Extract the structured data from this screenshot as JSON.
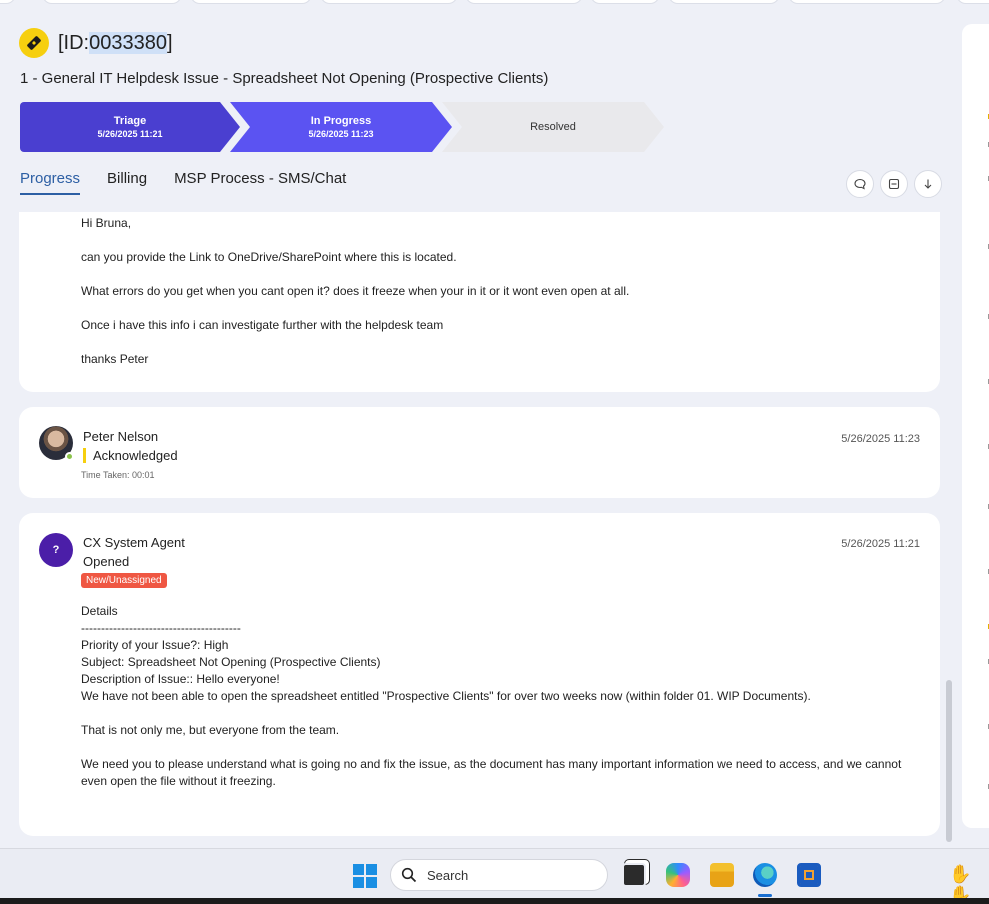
{
  "ticket": {
    "id_prefix": "[ID:",
    "id_number": "0033380",
    "id_suffix": "]",
    "title": "1 - General IT Helpdesk Issue - Spreadsheet Not Opening (Prospective Clients)"
  },
  "stepper": [
    {
      "label": "Triage",
      "date": "5/26/2025 11:21"
    },
    {
      "label": "In Progress",
      "date": "5/26/2025 11:23"
    },
    {
      "label": "Resolved",
      "date": ""
    }
  ],
  "tabs": [
    "Progress",
    "Billing",
    "MSP Process - SMS/Chat"
  ],
  "actions": {
    "comment_icon": "comment-icon",
    "collapse_icon": "collapse-icon",
    "download_icon": "download-icon"
  },
  "message": {
    "lines": [
      "Hi Bruna,",
      "can you provide the Link to OneDrive/SharePoint where this is located.",
      "What errors do you get when you cant open it? does it freeze when your in it or it wont even open at all.",
      "Once i have this info i can investigate further with the helpdesk team",
      "thanks Peter"
    ]
  },
  "activity_ack": {
    "author": "Peter Nelson",
    "state": "Acknowledged",
    "time_taken": "Time Taken: 00:01",
    "timestamp": "5/26/2025 11:23"
  },
  "activity_open": {
    "author": "CX System Agent",
    "state": "Opened",
    "badge": "New/Unassigned",
    "timestamp": "5/26/2025 11:21",
    "avatar_letter": "?",
    "details": [
      "Details",
      "----------------------------------------",
      "Priority of your Issue?: High",
      "Subject: Spreadsheet Not Opening (Prospective Clients)",
      "Description of Issue:: Hello everyone!",
      "We have not been able to open the spreadsheet entitled \"Prospective Clients\" for over two weeks now (within folder 01. WIP Documents).",
      "",
      "That is not only me, but everyone from the team.",
      "",
      "We need you to please understand what is going no and fix the issue, as the document has many important information we need to access, and we cannot even open the file without it freezing."
    ]
  },
  "taskbar": {
    "search_label": "Search",
    "colors": {
      "accent": "#1a8fe3"
    }
  },
  "colors": {
    "triage": "#4a3fd0",
    "in_progress": "#5b53f2",
    "resolved": "#e9e9ec",
    "badge": "#ef5743",
    "active_tab": "#2d5fa4"
  }
}
